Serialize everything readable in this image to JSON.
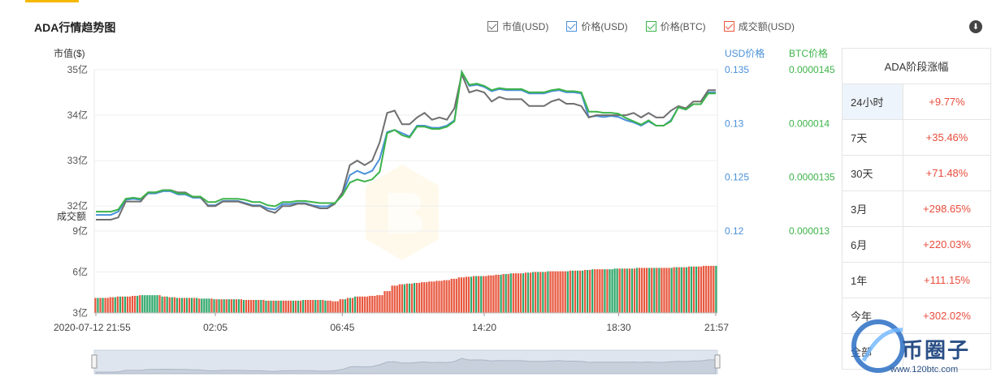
{
  "header": {
    "title": "ADA行情趋势图",
    "download_icon": "download-icon"
  },
  "legend": [
    {
      "label": "市值(USD)",
      "color": "#6f6f6f"
    },
    {
      "label": "价格(USD)",
      "color": "#4a90d9"
    },
    {
      "label": "价格(BTC)",
      "color": "#3db34a"
    },
    {
      "label": "成交额(USD)",
      "color": "#e8573e"
    }
  ],
  "axis_titles": {
    "market_cap": "市值($)",
    "usd_price": "USD价格",
    "btc_price": "BTC价格",
    "volume": "成交额"
  },
  "colors": {
    "market_cap": "#6f6f6f",
    "usd_price": "#4a90d9",
    "btc_price": "#3db34a",
    "volume_up": "#e8573e",
    "volume_down": "#2fa86b",
    "accent": "#f5b800",
    "change_positive": "#e84d3d"
  },
  "chart_data": {
    "type": "line",
    "x_ticks": [
      "2020-07-12 21:55",
      "02:05",
      "06:45",
      "14:20",
      "18:30",
      "21:57"
    ],
    "market_cap_axis": {
      "ticks": [
        "35亿",
        "34亿",
        "33亿",
        "32亿"
      ],
      "ylim": [
        31.45,
        35
      ]
    },
    "usd_price_axis": {
      "ticks": [
        "0.135",
        "0.13",
        "0.125",
        "0.12"
      ],
      "ylim": [
        0.12,
        0.135
      ]
    },
    "btc_price_axis": {
      "ticks": [
        "0.0000145",
        "0.000014",
        "0.0000135",
        "0.000013"
      ],
      "ylim": [
        1.3e-05,
        1.45e-05
      ]
    },
    "volume_axis": {
      "ticks": [
        "9亿",
        "6亿",
        "3亿"
      ],
      "ylim": [
        3,
        9
      ]
    },
    "market_cap_yi": [
      31.7,
      31.7,
      31.7,
      31.75,
      32.1,
      32.1,
      32.1,
      32.3,
      32.3,
      32.35,
      32.35,
      32.3,
      32.3,
      32.2,
      32.2,
      32.0,
      32.0,
      32.1,
      32.1,
      32.1,
      32.05,
      32.0,
      32.0,
      31.9,
      31.85,
      32.0,
      32.0,
      32.05,
      32.05,
      32.0,
      31.95,
      31.95,
      32.05,
      32.3,
      32.9,
      33.0,
      32.9,
      33.0,
      33.4,
      34.05,
      34.1,
      33.8,
      33.8,
      33.95,
      34.05,
      33.9,
      33.95,
      33.9,
      34.15,
      34.9,
      34.5,
      34.55,
      34.5,
      34.3,
      34.4,
      34.35,
      34.35,
      34.35,
      34.2,
      34.2,
      34.2,
      34.3,
      34.35,
      34.25,
      34.25,
      34.2,
      33.95,
      34.0,
      34.0,
      34.0,
      34.0,
      34.0,
      34.05,
      33.95,
      34.05,
      33.95,
      33.95,
      34.1,
      34.2,
      34.15,
      34.3,
      34.3,
      34.55,
      34.55
    ],
    "usd_price": [
      0.1215,
      0.1215,
      0.1215,
      0.1218,
      0.1229,
      0.123,
      0.1229,
      0.1235,
      0.1235,
      0.1237,
      0.1237,
      0.1234,
      0.1234,
      0.1231,
      0.1231,
      0.1224,
      0.1224,
      0.1228,
      0.1228,
      0.1228,
      0.1226,
      0.1224,
      0.1224,
      0.1221,
      0.122,
      0.1225,
      0.1225,
      0.1226,
      0.1226,
      0.1224,
      0.1223,
      0.1223,
      0.1226,
      0.1234,
      0.1252,
      0.1256,
      0.1253,
      0.1256,
      0.1267,
      0.1292,
      0.1294,
      0.1291,
      0.1288,
      0.1298,
      0.1298,
      0.1296,
      0.1296,
      0.1298,
      0.1303,
      0.1348,
      0.1335,
      0.1336,
      0.1334,
      0.133,
      0.1332,
      0.1331,
      0.1331,
      0.1331,
      0.1328,
      0.1328,
      0.1328,
      0.133,
      0.1331,
      0.1329,
      0.1329,
      0.1328,
      0.1306,
      0.1307,
      0.1306,
      0.1307,
      0.1306,
      0.1303,
      0.1301,
      0.1298,
      0.1302,
      0.1298,
      0.1298,
      0.1303,
      0.1315,
      0.1313,
      0.1318,
      0.1318,
      0.1329,
      0.1329
    ],
    "btc_price": [
      1.318e-05,
      1.318e-05,
      1.318e-05,
      1.32e-05,
      1.33e-05,
      1.331e-05,
      1.33e-05,
      1.336e-05,
      1.336e-05,
      1.338e-05,
      1.338e-05,
      1.335e-05,
      1.335e-05,
      1.332e-05,
      1.332e-05,
      1.327e-05,
      1.327e-05,
      1.33e-05,
      1.33e-05,
      1.33e-05,
      1.329e-05,
      1.327e-05,
      1.327e-05,
      1.324e-05,
      1.323e-05,
      1.327e-05,
      1.327e-05,
      1.328e-05,
      1.328e-05,
      1.327e-05,
      1.326e-05,
      1.326e-05,
      1.326e-05,
      1.333e-05,
      1.345e-05,
      1.348e-05,
      1.346e-05,
      1.348e-05,
      1.355e-05,
      1.391e-05,
      1.394e-05,
      1.389e-05,
      1.387e-05,
      1.397e-05,
      1.397e-05,
      1.395e-05,
      1.395e-05,
      1.397e-05,
      1.402e-05,
      1.448e-05,
      1.436e-05,
      1.437e-05,
      1.435e-05,
      1.431e-05,
      1.433e-05,
      1.432e-05,
      1.432e-05,
      1.432e-05,
      1.429e-05,
      1.429e-05,
      1.429e-05,
      1.431e-05,
      1.432e-05,
      1.43e-05,
      1.43e-05,
      1.429e-05,
      1.411e-05,
      1.411e-05,
      1.41e-05,
      1.41e-05,
      1.409e-05,
      1.405e-05,
      1.402e-05,
      1.399e-05,
      1.403e-05,
      1.398e-05,
      1.398e-05,
      1.402e-05,
      1.415e-05,
      1.413e-05,
      1.418e-05,
      1.418e-05,
      1.428e-05,
      1.428e-05
    ],
    "volume_yi": [
      4.1,
      4.1,
      4.15,
      4.2,
      4.2,
      4.25,
      4.3,
      4.3,
      4.3,
      4.2,
      4.15,
      4.1,
      4.1,
      4.1,
      4.05,
      4.05,
      4.0,
      4.0,
      4.0,
      4.0,
      3.95,
      3.95,
      3.95,
      3.9,
      3.9,
      3.9,
      3.9,
      3.9,
      3.95,
      3.95,
      3.95,
      3.9,
      3.85,
      4.0,
      4.1,
      4.2,
      4.2,
      4.25,
      4.3,
      4.6,
      5.0,
      5.1,
      5.15,
      5.2,
      5.25,
      5.3,
      5.35,
      5.4,
      5.5,
      5.6,
      5.65,
      5.7,
      5.7,
      5.75,
      5.8,
      5.85,
      5.9,
      5.9,
      5.95,
      6.0,
      6.0,
      6.05,
      6.05,
      6.05,
      6.1,
      6.1,
      6.15,
      6.2,
      6.2,
      6.2,
      6.25,
      6.25,
      6.25,
      6.3,
      6.3,
      6.3,
      6.3,
      6.3,
      6.35,
      6.35,
      6.4,
      6.4,
      6.45,
      6.45
    ],
    "volume_up": [
      1,
      0,
      1,
      1,
      0,
      1,
      1,
      0,
      0,
      0,
      1,
      0,
      1,
      0,
      1,
      0,
      0,
      1,
      0,
      1,
      0,
      1,
      1,
      0,
      1,
      0,
      1,
      1,
      0,
      1,
      1,
      0,
      1,
      1,
      1,
      0,
      1,
      1,
      1,
      1,
      1,
      1,
      1,
      0,
      1,
      1,
      1,
      1,
      1,
      1,
      1,
      1,
      0,
      1,
      1,
      1,
      0,
      1,
      1,
      0,
      1,
      0,
      1,
      1,
      1,
      0,
      1,
      0,
      1,
      1,
      0,
      0,
      1,
      0,
      1,
      1,
      0,
      1,
      1,
      0,
      1,
      0,
      1,
      1
    ]
  },
  "performance_table": {
    "title": "ADA阶段涨幅",
    "rows": [
      {
        "period": "24小时",
        "change": "+9.77%"
      },
      {
        "period": "7天",
        "change": "+35.46%"
      },
      {
        "period": "30天",
        "change": "+71.48%"
      },
      {
        "period": "3月",
        "change": "+298.65%"
      },
      {
        "period": "6月",
        "change": "+220.03%"
      },
      {
        "period": "1年",
        "change": "+111.15%"
      },
      {
        "period": "今年",
        "change": "+302.02%"
      },
      {
        "period": "全部",
        "change": ""
      }
    ]
  },
  "watermark": {
    "brand": "币圈子",
    "url": "www.120btc.com"
  }
}
